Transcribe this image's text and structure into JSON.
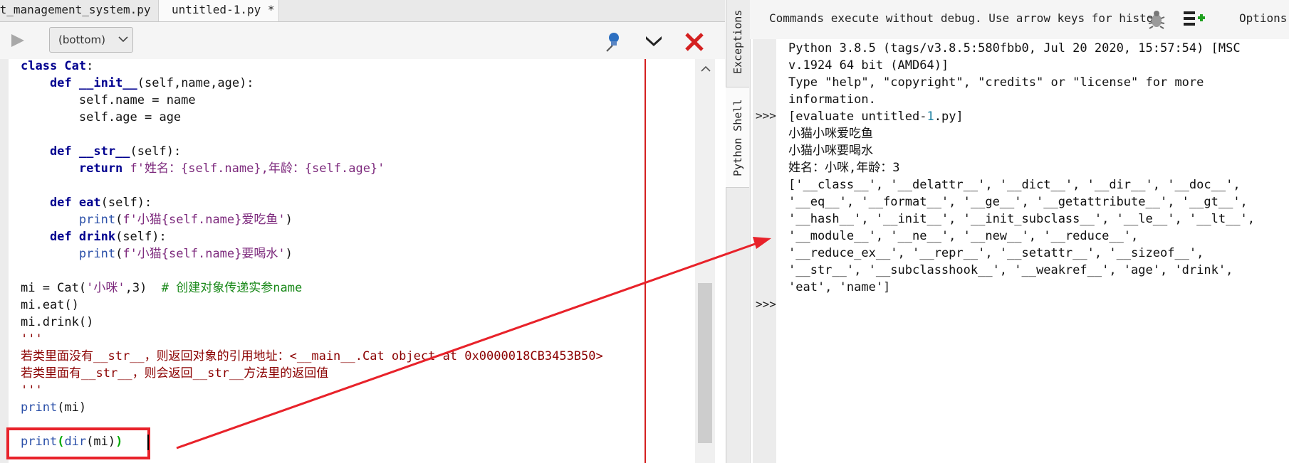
{
  "tabs": [
    {
      "label": "nt_management_system.py"
    },
    {
      "label": "untitled-1.py *"
    }
  ],
  "toolbar": {
    "scope": "(bottom)"
  },
  "editor": {
    "lines": [
      [
        {
          "t": "class ",
          "c": "kw"
        },
        {
          "t": "Cat",
          "c": "kw"
        },
        {
          "t": ":",
          "c": "txt"
        }
      ],
      [
        {
          "t": "    def ",
          "c": "kw"
        },
        {
          "t": "__init__",
          "c": "kw"
        },
        {
          "t": "(self,name,age):",
          "c": "txt"
        }
      ],
      [
        {
          "t": "        self.name = name",
          "c": "txt"
        }
      ],
      [
        {
          "t": "        self.age = age",
          "c": "txt"
        }
      ],
      [],
      [
        {
          "t": "    def ",
          "c": "kw"
        },
        {
          "t": "__str__",
          "c": "kw"
        },
        {
          "t": "(self):",
          "c": "txt"
        }
      ],
      [
        {
          "t": "        return ",
          "c": "kw"
        },
        {
          "t": "f'姓名：{self.name},年龄：{self.age}'",
          "c": "str"
        }
      ],
      [],
      [
        {
          "t": "    def ",
          "c": "kw"
        },
        {
          "t": "eat",
          "c": "kw"
        },
        {
          "t": "(self):",
          "c": "txt"
        }
      ],
      [
        {
          "t": "        ",
          "c": "txt"
        },
        {
          "t": "print",
          "c": "bi"
        },
        {
          "t": "(",
          "c": "txt"
        },
        {
          "t": "f'小猫{self.name}爱吃鱼'",
          "c": "str"
        },
        {
          "t": ")",
          "c": "txt"
        }
      ],
      [
        {
          "t": "    def ",
          "c": "kw"
        },
        {
          "t": "drink",
          "c": "kw"
        },
        {
          "t": "(self):",
          "c": "txt"
        }
      ],
      [
        {
          "t": "        ",
          "c": "txt"
        },
        {
          "t": "print",
          "c": "bi"
        },
        {
          "t": "(",
          "c": "txt"
        },
        {
          "t": "f'小猫{self.name}要喝水'",
          "c": "str"
        },
        {
          "t": ")",
          "c": "txt"
        }
      ],
      [],
      [
        {
          "t": "mi = Cat(",
          "c": "txt"
        },
        {
          "t": "'小咪'",
          "c": "str"
        },
        {
          "t": ",3)  ",
          "c": "txt"
        },
        {
          "t": "# 创建对象传递实参name",
          "c": "cmt"
        }
      ],
      [
        {
          "t": "mi.eat()",
          "c": "txt"
        }
      ],
      [
        {
          "t": "mi.drink()",
          "c": "txt"
        }
      ],
      [
        {
          "t": "'''",
          "c": "doc"
        }
      ],
      [
        {
          "t": "若类里面没有__str__，则返回对象的引用地址：<__main__.Cat object at 0x0000018CB3453B50>",
          "c": "doc"
        }
      ],
      [
        {
          "t": "若类里面有__str__，则会返回__str__方法里的返回值",
          "c": "doc"
        }
      ],
      [
        {
          "t": "'''",
          "c": "doc"
        }
      ],
      [
        {
          "t": "print",
          "c": "bi"
        },
        {
          "t": "(mi)",
          "c": "txt"
        }
      ],
      [],
      [
        {
          "t": "print",
          "c": "bi"
        },
        {
          "t": "(",
          "c": "paren-hl"
        },
        {
          "t": "dir",
          "c": "bi"
        },
        {
          "t": "(mi)",
          "c": "txt"
        },
        {
          "t": ")",
          "c": "paren-hl"
        }
      ]
    ]
  },
  "side_tabs": {
    "exceptions": "Exceptions",
    "shell": "Python Shell"
  },
  "shell": {
    "hint": "Commands execute without debug.  Use arrow keys for histo",
    "options": "Options",
    "prompt": ">>>",
    "lines": [
      [
        {
          "t": "Python 3.8.5 (tags/v3.8.5:580fbb0, Jul 20 2020, 15:57:54) [MSC",
          "c": ""
        }
      ],
      [
        {
          "t": "v.1924 64 bit (AMD64)]",
          "c": ""
        }
      ],
      [
        {
          "t": "Type \"help\", \"copyright\", \"credits\" or \"license\" for more",
          "c": ""
        }
      ],
      [
        {
          "t": "information.",
          "c": ""
        }
      ],
      [
        {
          "t": "[evaluate untitled-",
          "c": ""
        },
        {
          "t": "1",
          "c": "num"
        },
        {
          "t": ".py]",
          "c": ""
        }
      ],
      [
        {
          "t": "小猫小咪爱吃鱼",
          "c": ""
        }
      ],
      [
        {
          "t": "小猫小咪要喝水",
          "c": ""
        }
      ],
      [
        {
          "t": "姓名：小咪,年龄：3",
          "c": ""
        }
      ],
      [
        {
          "t": "['__class__', '__delattr__', '__dict__', '__dir__', '__doc__',",
          "c": ""
        }
      ],
      [
        {
          "t": "'__eq__', '__format__', '__ge__', '__getattribute__', '__gt__',",
          "c": ""
        }
      ],
      [
        {
          "t": "'__hash__', '__init__', '__init_subclass__', '__le__', '__lt__',",
          "c": ""
        }
      ],
      [
        {
          "t": "'__module__', '__ne__', '__new__', '__reduce__',",
          "c": ""
        }
      ],
      [
        {
          "t": "'__reduce_ex__', '__repr__', '__setattr__', '__sizeof__',",
          "c": ""
        }
      ],
      [
        {
          "t": "'__str__', '__subclasshook__', '__weakref__', 'age', 'drink',",
          "c": ""
        }
      ],
      [
        {
          "t": "'eat', 'name']",
          "c": ""
        }
      ]
    ]
  },
  "colors": {
    "annotation_red": "#e8222a",
    "close_red": "#d42020",
    "add_green": "#1fa01f"
  }
}
